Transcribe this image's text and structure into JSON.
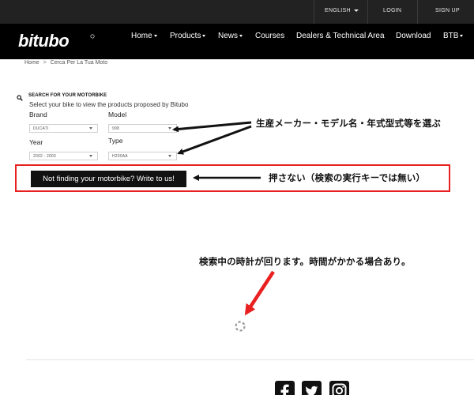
{
  "topbar": {
    "language": "ENGLISH",
    "login": "LOGIN",
    "signup": "SIGN UP"
  },
  "nav": {
    "logo_text": "bitubo",
    "items": [
      {
        "label": "Home",
        "dropdown": true
      },
      {
        "label": "Products",
        "dropdown": true
      },
      {
        "label": "News",
        "dropdown": true
      },
      {
        "label": "Courses",
        "dropdown": false
      },
      {
        "label": "Dealers & Technical Area",
        "dropdown": false
      },
      {
        "label": "Download",
        "dropdown": false
      },
      {
        "label": "BTB",
        "dropdown": true
      }
    ]
  },
  "breadcrumb": {
    "home": "Home",
    "separator": ">",
    "current": "Cerca Per La Tua Moto"
  },
  "search": {
    "title": "SEARCH FOR YOUR MOTORBIKE",
    "subtitle": "Select your bike to view the products proposed by Bitubo",
    "brand_label": "Brand",
    "brand_value": "DUCATI",
    "model_label": "Model",
    "model_value": "998",
    "year_label": "Year",
    "year_value": "2002 - 2003",
    "type_label": "Type",
    "type_value": "H200AA",
    "write_button": "Not finding your motorbike? Write to us!"
  },
  "annotations": {
    "select_note": "生産メーカー・モデル名・年式型式等を選ぶ",
    "button_note": "押さない（検索の実行キーでは無い）",
    "spinner_note": "検索中の時計が回ります。時間がかかる場合あり。"
  },
  "colors": {
    "accent_red": "#e82020",
    "nav_black": "#000000",
    "topbar": "#222222"
  },
  "footer": {
    "social_icons": [
      "facebook-icon",
      "twitter-icon",
      "instagram-icon"
    ]
  }
}
